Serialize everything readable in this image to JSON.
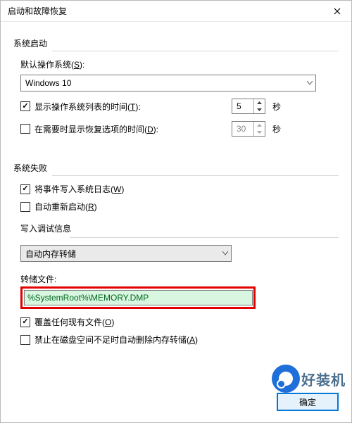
{
  "window": {
    "title": "启动和故障恢复"
  },
  "system_startup": {
    "header": "系统启动",
    "default_os_label": "默认操作系统(",
    "default_os_hotkey": "S",
    "default_os_value": "Windows 10",
    "show_list_label": "显示操作系统列表的时间(",
    "show_list_hotkey": "T",
    "show_list_value": "5",
    "show_recovery_label": "在需要时显示恢复选项的时间(",
    "show_recovery_hotkey": "D",
    "show_recovery_value": "30",
    "seconds_unit": "秒"
  },
  "system_failure": {
    "header": "系统失败",
    "write_event_label": "将事件写入系统日志(",
    "write_event_hotkey": "W",
    "auto_restart_label": "自动重新启动(",
    "auto_restart_hotkey": "R",
    "debug_info_header": "写入调试信息",
    "dump_type_value": "自动内存转储",
    "dump_file_label": "转储文件:",
    "dump_file_value": "%SystemRoot%\\MEMORY.DMP",
    "overwrite_label": "覆盖任何现有文件(",
    "overwrite_hotkey": "O",
    "disable_delete_label": "禁止在磁盘空间不足时自动删除内存转储(",
    "disable_delete_hotkey": "A"
  },
  "buttons": {
    "ok": "确定"
  },
  "watermark": {
    "text": "好装机"
  },
  "closing_paren": ")",
  "colon": "):"
}
